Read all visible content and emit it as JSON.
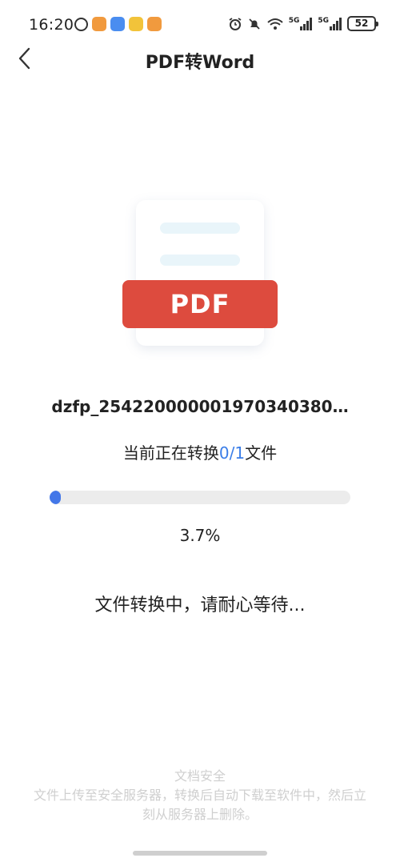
{
  "status_bar": {
    "time": "16:20",
    "battery": "52",
    "signal_1": "5G",
    "signal_2": "5G",
    "icons": [
      "circle-badge-icon",
      "orange-heart-app-icon",
      "blue-chat-app-icon",
      "weather-app-icon",
      "orange-heart-app-icon"
    ],
    "right_icons": [
      "alarm-icon",
      "mute-bell-icon",
      "wifi-icon",
      "signal-5g-icon",
      "signal-5g-icon",
      "battery-icon"
    ]
  },
  "header": {
    "title": "PDF转Word",
    "back_icon": "chevron-left-icon"
  },
  "illustration": {
    "badge_label": "PDF",
    "badge_color": "#dd4b3e"
  },
  "conversion": {
    "file_name": "dzfp_254220000001970340380…",
    "count_prefix": "当前正在转换",
    "count_done": "0",
    "count_sep": "/",
    "count_total": "1",
    "count_suffix": "文件",
    "progress_percent": 3.7,
    "progress_text": "3.7%",
    "message": "文件转换中，请耐心等待..."
  },
  "security": {
    "title": "文档安全",
    "description": "文件上传至安全服务器，转换后自动下载至软件中，然后立刻从服务器上删除。"
  },
  "colors": {
    "accent": "#4377e8",
    "pdf_red": "#dd4b3e",
    "muted_text": "#cfcfcf"
  }
}
